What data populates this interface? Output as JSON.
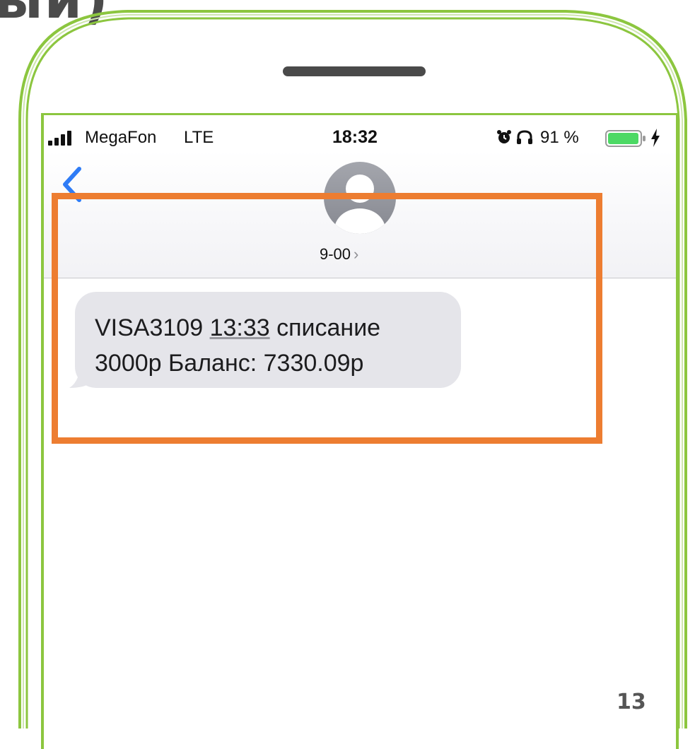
{
  "slide": {
    "corner_title": "ый)",
    "page_number": "13"
  },
  "status_bar": {
    "carrier": "MegaFon",
    "network": "LTE",
    "time": "18:32",
    "battery_percent": "91 %",
    "icons": [
      "signal-bars-icon",
      "alarm-icon",
      "headphones-icon",
      "battery-icon",
      "charging-icon"
    ]
  },
  "conversation": {
    "contact_name": "9-00",
    "contact_chevron": "›",
    "back_icon": "chevron-left-icon",
    "avatar_icon": "person-avatar-icon"
  },
  "message": {
    "line1_prefix": "VISA3109 ",
    "line1_time": "13:33",
    "line1_suffix": " списание",
    "line2": "3000р Баланс: 7330.09р"
  },
  "colors": {
    "frame_green": "#8cc63f",
    "highlight_orange": "#ed7d31",
    "ios_blue": "#2f7cf6",
    "bubble_gray": "#e5e5ea",
    "battery_green": "#4cd964"
  }
}
